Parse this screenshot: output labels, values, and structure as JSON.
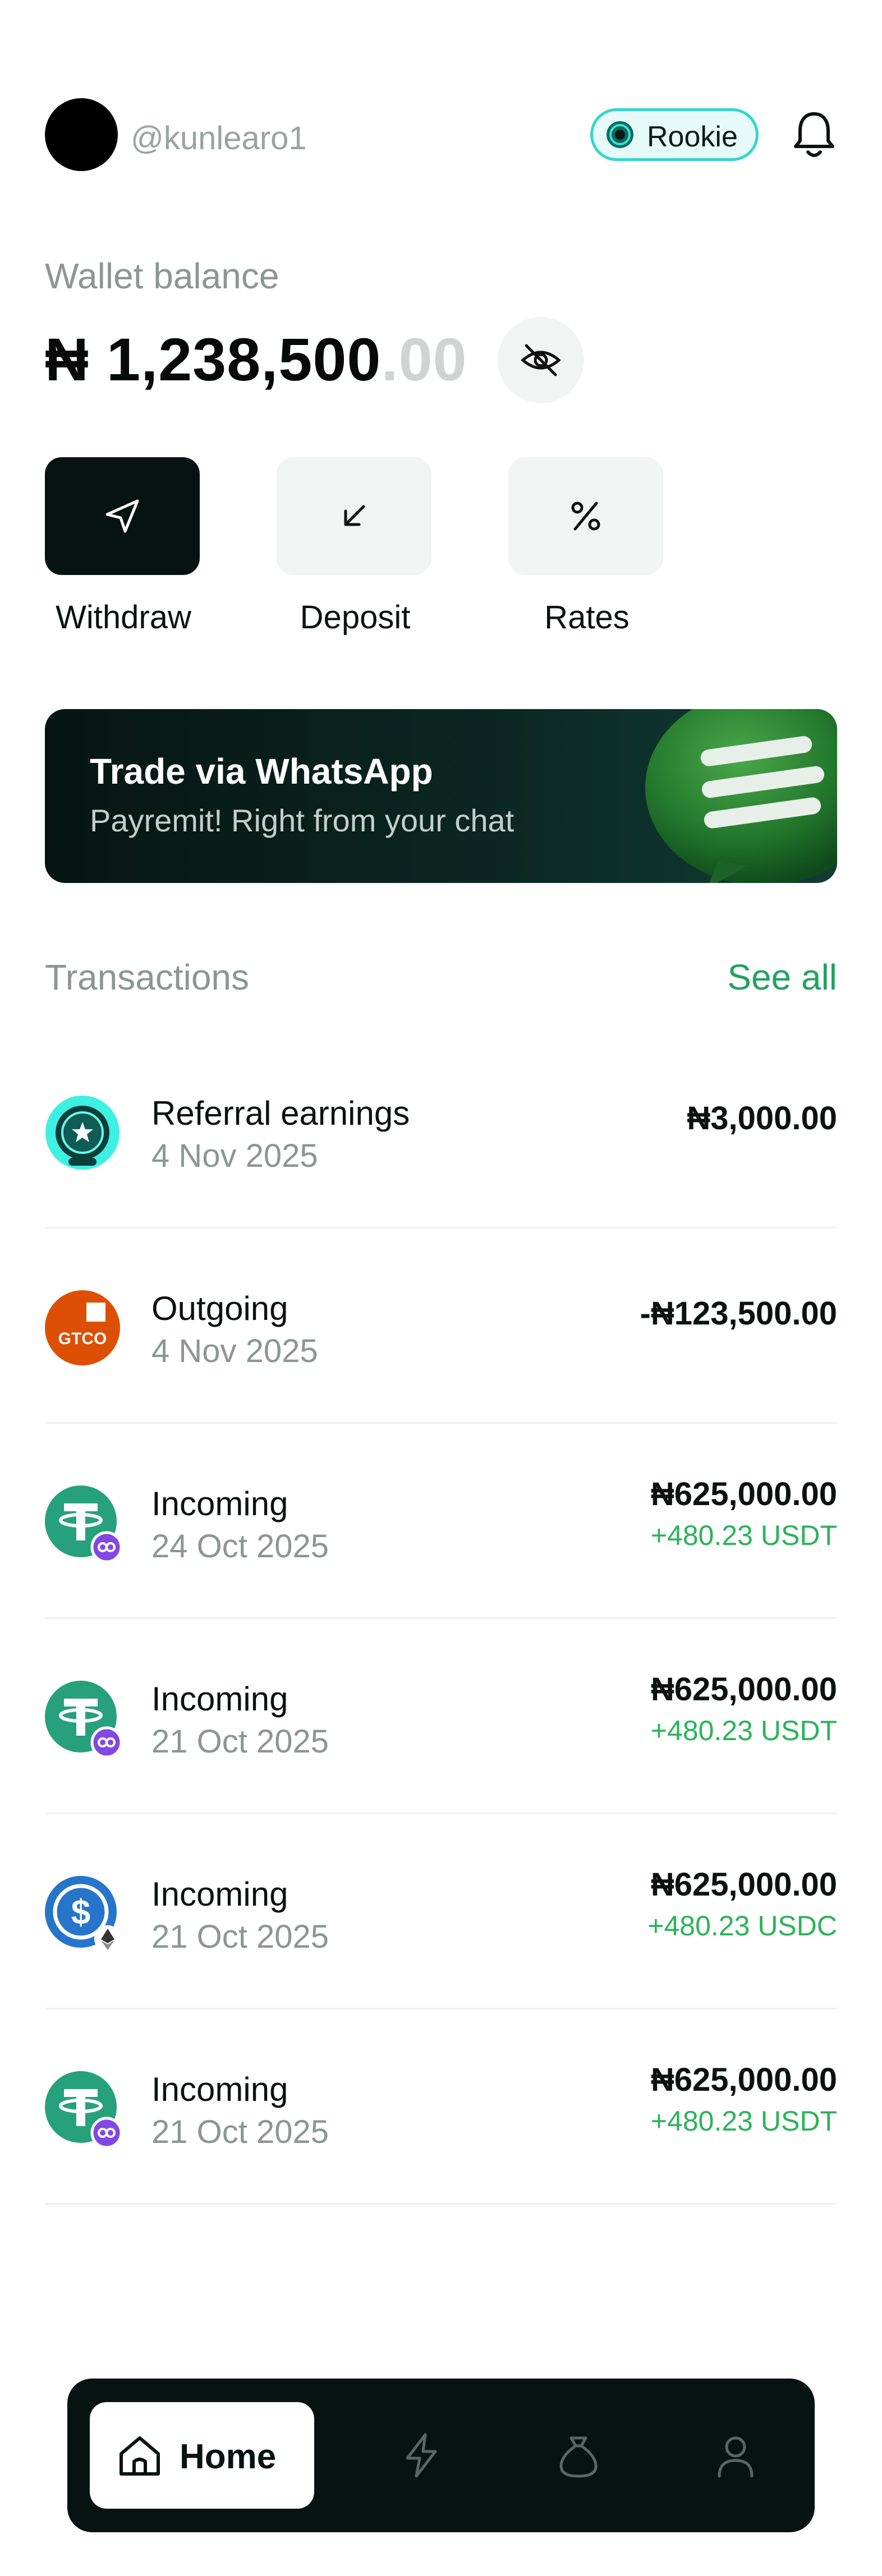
{
  "header": {
    "username": "@kunlearo1",
    "badge_label": "Rookie"
  },
  "balance": {
    "label": "Wallet balance",
    "amount_main": "₦ 1,238,500",
    "amount_decimal": ".00"
  },
  "actions": [
    {
      "label": "Withdraw",
      "icon": "send-icon"
    },
    {
      "label": "Deposit",
      "icon": "arrow-down-left-icon"
    },
    {
      "label": "Rates",
      "icon": "percent-icon"
    }
  ],
  "banner": {
    "title": "Trade via WhatsApp",
    "subtitle": "Payremit! Right from your chat"
  },
  "transactions_section": {
    "heading": "Transactions",
    "see_all": "See all"
  },
  "transactions": [
    {
      "title": "Referral earnings",
      "date": "4 Nov 2025",
      "amount": "₦3,000.00",
      "sub": "",
      "icon": "referral-badge-icon"
    },
    {
      "title": "Outgoing",
      "date": "4 Nov 2025",
      "amount": "-₦123,500.00",
      "sub": "",
      "icon": "gtco-bank-icon",
      "icon_text": "GTCO"
    },
    {
      "title": "Incoming",
      "date": "24 Oct 2025",
      "amount": "₦625,000.00",
      "sub": "+480.23 USDT",
      "icon": "tether-polygon-icon"
    },
    {
      "title": "Incoming",
      "date": "21 Oct 2025",
      "amount": "₦625,000.00",
      "sub": "+480.23 USDT",
      "icon": "tether-polygon-icon"
    },
    {
      "title": "Incoming",
      "date": "21 Oct 2025",
      "amount": "₦625,000.00",
      "sub": "+480.23 USDC",
      "icon": "usdc-ethereum-icon"
    },
    {
      "title": "Incoming",
      "date": "21 Oct 2025",
      "amount": "₦625,000.00",
      "sub": "+480.23 USDT",
      "icon": "tether-polygon-icon"
    }
  ],
  "nav": {
    "home_label": "Home",
    "items": [
      "home-icon",
      "lightning-icon",
      "money-bag-icon",
      "user-icon"
    ]
  },
  "colors": {
    "accent_green": "#22a25f",
    "dark": "#061311",
    "badge_border": "#33d6cb",
    "tether": "#26a17b",
    "polygon": "#8247e5",
    "usdc": "#2775ca",
    "gtco": "#dd4f05"
  }
}
